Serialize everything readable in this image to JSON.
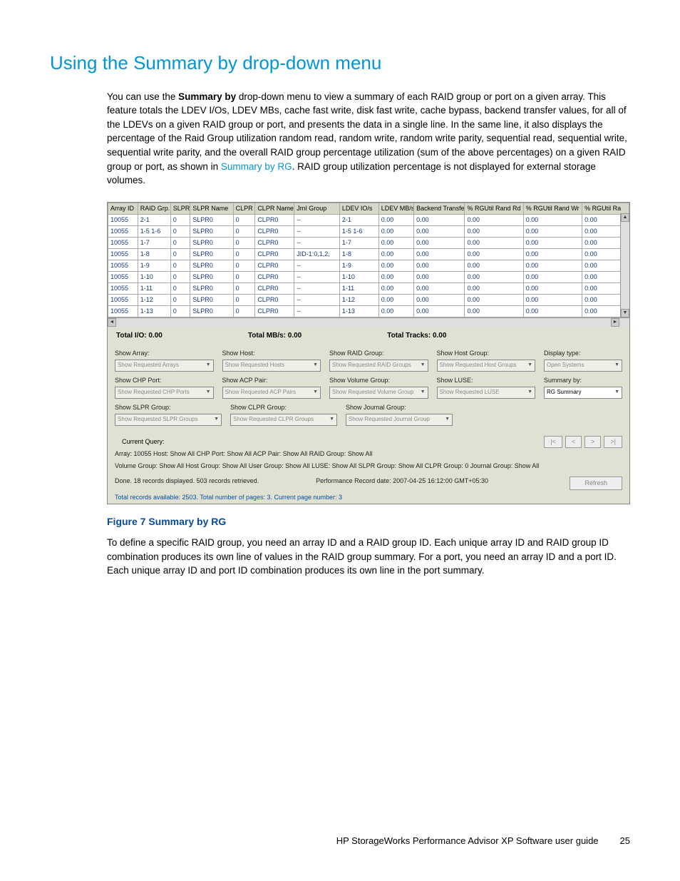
{
  "heading": "Using the Summary by drop-down menu",
  "paragraph1_prefix": "You can use the ",
  "paragraph1_bold": "Summary by",
  "paragraph1_mid": " drop-down menu to view a summary of each RAID group or port on a given array. This feature totals the LDEV I/Os, LDEV MBs, cache fast write, disk fast write, cache bypass, backend transfer values, for all of the LDEVs on a given RAID group or port, and presents the data in a single line. In the same line, it also displays the percentage of the Raid Group utilization random read, random write, random write parity, sequential read, sequential write, sequential write parity, and the overall RAID group percentage utilization (sum of the above percentages) on a given RAID group or port, as shown in ",
  "paragraph1_link": "Summary by RG",
  "paragraph1_suffix": ". RAID group utilization percentage is not displayed for external storage volumes.",
  "figure_caption": "Figure 7 Summary by RG",
  "paragraph2": "To define a specific RAID group, you need an array ID and a RAID group ID. Each unique array ID and RAID group ID combination produces its own line of values in the RAID group summary. For a port, you need an array ID and a port ID. Each unique array ID and port ID combination produces its own line in the port summary.",
  "footer_title": "HP StorageWorks Performance Advisor XP Software user guide",
  "footer_page": "25",
  "grid": {
    "headers": [
      "Array ID",
      "RAID Grp.",
      "SLPR",
      "SLPR Name",
      "CLPR",
      "CLPR Name",
      "Jrnl Group",
      "LDEV IO/s",
      "LDEV MB/s",
      "Backend Transfer",
      "% RGUtil Rand Rd",
      "% RGUtil Rand Wr",
      "% RGUtil Ra"
    ],
    "colwidths": [
      "38",
      "42",
      "25",
      "55",
      "28",
      "50",
      "58",
      "50",
      "45",
      "65",
      "75",
      "75",
      "60"
    ],
    "rows": [
      [
        "10055",
        "2-1",
        "0",
        "SLPR0",
        "0",
        "CLPR0",
        "--",
        "2-1",
        "0.00",
        "0.00",
        "0.00",
        "0.00",
        "0.00"
      ],
      [
        "10055",
        "1-5 1-6",
        "0",
        "SLPR0",
        "0",
        "CLPR0",
        "--",
        "1-5 1-6",
        "0.00",
        "0.00",
        "0.00",
        "0.00",
        "0.00"
      ],
      [
        "10055",
        "1-7",
        "0",
        "SLPR0",
        "0",
        "CLPR0",
        "--",
        "1-7",
        "0.00",
        "0.00",
        "0.00",
        "0.00",
        "0.00"
      ],
      [
        "10055",
        "1-8",
        "0",
        "SLPR0",
        "0",
        "CLPR0",
        "JID-1:0,1,2,",
        "1-8",
        "0.00",
        "0.00",
        "0.00",
        "0.00",
        "0.00"
      ],
      [
        "10055",
        "1-9",
        "0",
        "SLPR0",
        "0",
        "CLPR0",
        "--",
        "1-9",
        "0.00",
        "0.00",
        "0.00",
        "0.00",
        "0.00"
      ],
      [
        "10055",
        "1-10",
        "0",
        "SLPR0",
        "0",
        "CLPR0",
        "--",
        "1-10",
        "0.00",
        "0.00",
        "0.00",
        "0.00",
        "0.00"
      ],
      [
        "10055",
        "1-11",
        "0",
        "SLPR0",
        "0",
        "CLPR0",
        "--",
        "1-11",
        "0.00",
        "0.00",
        "0.00",
        "0.00",
        "0.00"
      ],
      [
        "10055",
        "1-12",
        "0",
        "SLPR0",
        "0",
        "CLPR0",
        "--",
        "1-12",
        "0.00",
        "0.00",
        "0.00",
        "0.00",
        "0.00"
      ],
      [
        "10055",
        "1-13",
        "0",
        "SLPR0",
        "0",
        "CLPR0",
        "--",
        "1-13",
        "0.00",
        "0.00",
        "0.00",
        "0.00",
        "0.00"
      ]
    ]
  },
  "totals": {
    "io": "Total I/O: 0.00",
    "mb": "Total MB/s: 0.00",
    "tracks": "Total Tracks: 0.00"
  },
  "filters": {
    "row1": [
      {
        "label": "Show Array:",
        "value": "Show Requested Arrays"
      },
      {
        "label": "Show Host:",
        "value": "Show Requested Hosts"
      },
      {
        "label": "Show RAID Group:",
        "value": "Show Requested RAID Groups"
      },
      {
        "label": "Show Host Group:",
        "value": "Show Requested Host Groups"
      }
    ],
    "row2": [
      {
        "label": "Show CHP Port:",
        "value": "Show Requested CHP Ports"
      },
      {
        "label": "Show ACP Pair:",
        "value": "Show Requested ACP Pairs"
      },
      {
        "label": "Show Volume Group:",
        "value": "Show Requested Volume Group"
      },
      {
        "label": "Show LUSE:",
        "value": "Show Requested LUSE"
      }
    ],
    "row3": [
      {
        "label": "Show SLPR Group:",
        "value": "Show Requested SLPR Groups"
      },
      {
        "label": "Show CLPR Group:",
        "value": "Show Requested CLPR Groups"
      },
      {
        "label": "Show Journal Group:",
        "value": "Show Requested Journal Group"
      }
    ],
    "display_type": {
      "label": "Display type:",
      "value": "Open Systems"
    },
    "summary_by": {
      "label": "Summary by:",
      "value": "RG Summary"
    }
  },
  "query": {
    "label": "Current Query:",
    "line1": "Array: 10055      Host: Show All      CHP Port: Show All      ACP Pair: Show All      RAID Group: Show All",
    "line2_left": "Volume Group: Show All      Host Group: Show All      User Group: Show All      LUSE: Show All      SLPR Group: Show All      CLPR Group: 0      Journal Group: Show All",
    "done": "Done. 18 records displayed. 503 records retrieved.",
    "perf": "Performance Record date: 2007-04-25 16:12:00 GMT+05:30",
    "totals": "Total records available: 2503.  Total number of pages: 3.  Current page number: 3"
  },
  "nav": {
    "first": "|<",
    "prev": "<",
    "next": ">",
    "last": ">|"
  },
  "refresh": "Refresh"
}
